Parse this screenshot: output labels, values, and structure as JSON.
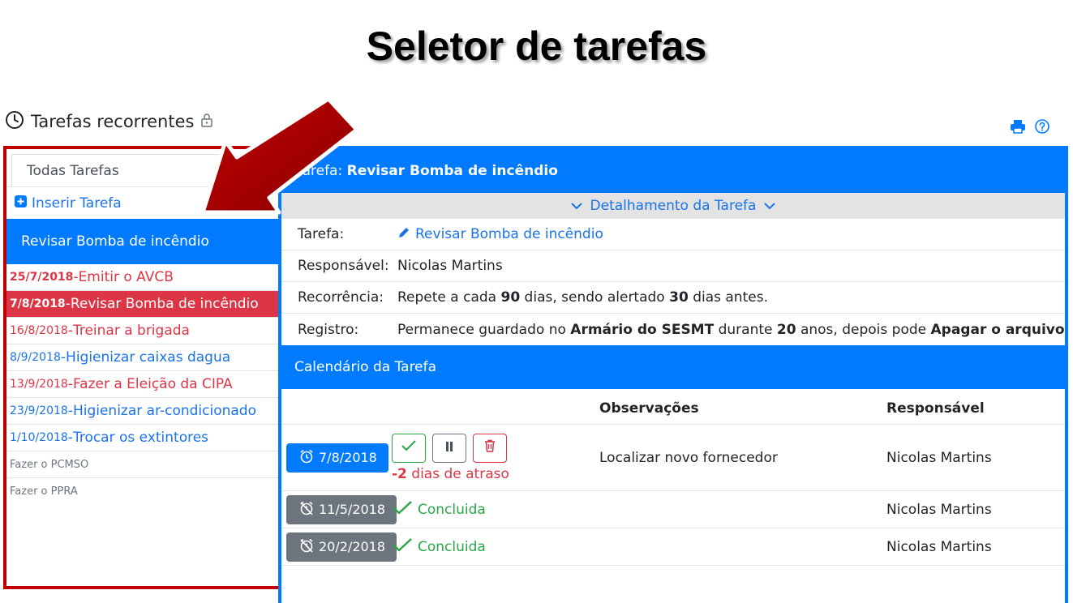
{
  "slide": {
    "title": "Seletor de tarefas"
  },
  "header": {
    "title": "Tarefas recorrentes"
  },
  "sidebar": {
    "filter": "Todas Tarefas",
    "insert_label": "Inserir Tarefa",
    "selected": "Revisar Bomba de incêndio",
    "tasks": [
      {
        "date": "25/7/2018",
        "sep": " - ",
        "name": "Emitir o AVCB"
      },
      {
        "date": "7/8/2018",
        "sep": " - ",
        "name": "Revisar Bomba de incêndio"
      },
      {
        "date": "16/8/2018",
        "sep": " - ",
        "name": "Treinar a brigada"
      },
      {
        "date": "8/9/2018",
        "sep": " - ",
        "name": "Higienizar caixas dagua"
      },
      {
        "date": "13/9/2018",
        "sep": " - ",
        "name": "Fazer a Eleição da CIPA"
      },
      {
        "date": "23/9/2018",
        "sep": " - ",
        "name": "Higienizar ar-condicionado"
      },
      {
        "date": "1/10/2018",
        "sep": " - ",
        "name": "Trocar os extintores"
      },
      {
        "name": "Fazer o PCMSO"
      },
      {
        "name": "Fazer o PPRA"
      }
    ]
  },
  "panel": {
    "header_prefix": "Tarefa: ",
    "header_task": "Revisar Bomba de incêndio",
    "detail_toggle": "Detalhamento da Tarefa",
    "details": {
      "task_label": "Tarefa:",
      "task_value": "Revisar Bomba de incêndio",
      "resp_label": "Responsável:",
      "resp_value": "Nicolas Martins",
      "rec_label": "Recorrência:",
      "rec_parts": [
        "Repete a cada ",
        "90",
        " dias, sendo alertado ",
        "30",
        " dias antes."
      ],
      "reg_label": "Registro:",
      "reg_parts": [
        "Permanece guardado no ",
        "Armário do SESMT",
        " durante ",
        "20",
        " anos, depois pode ",
        "Apagar o arquivo"
      ]
    }
  },
  "calendar": {
    "title": "Calendário da Tarefa",
    "col_obs": "Observações",
    "col_resp": "Responsável",
    "rows": [
      {
        "date": "7/8/2018",
        "late_value": "-2",
        "late_text": " dias de atraso",
        "obs": "Localizar novo fornecedor",
        "resp": "Nicolas Martins"
      },
      {
        "date": "11/5/2018",
        "status": "Concluida",
        "resp": "Nicolas Martins"
      },
      {
        "date": "20/2/2018",
        "status": "Concluida",
        "resp": "Nicolas Martins"
      }
    ]
  },
  "colors": {
    "primary": "#007bff",
    "danger": "#dc3545",
    "success": "#28a745",
    "secondary": "#6c757d",
    "highlight_border": "#c00000"
  },
  "icons": [
    "clock-icon",
    "lock-icon",
    "print-icon",
    "help-icon",
    "plus-square-icon",
    "chevron-down-icon",
    "pencil-icon",
    "alarm-icon",
    "alarm-off-icon",
    "check-icon",
    "pause-icon",
    "trash-icon",
    "arrow-icon"
  ]
}
